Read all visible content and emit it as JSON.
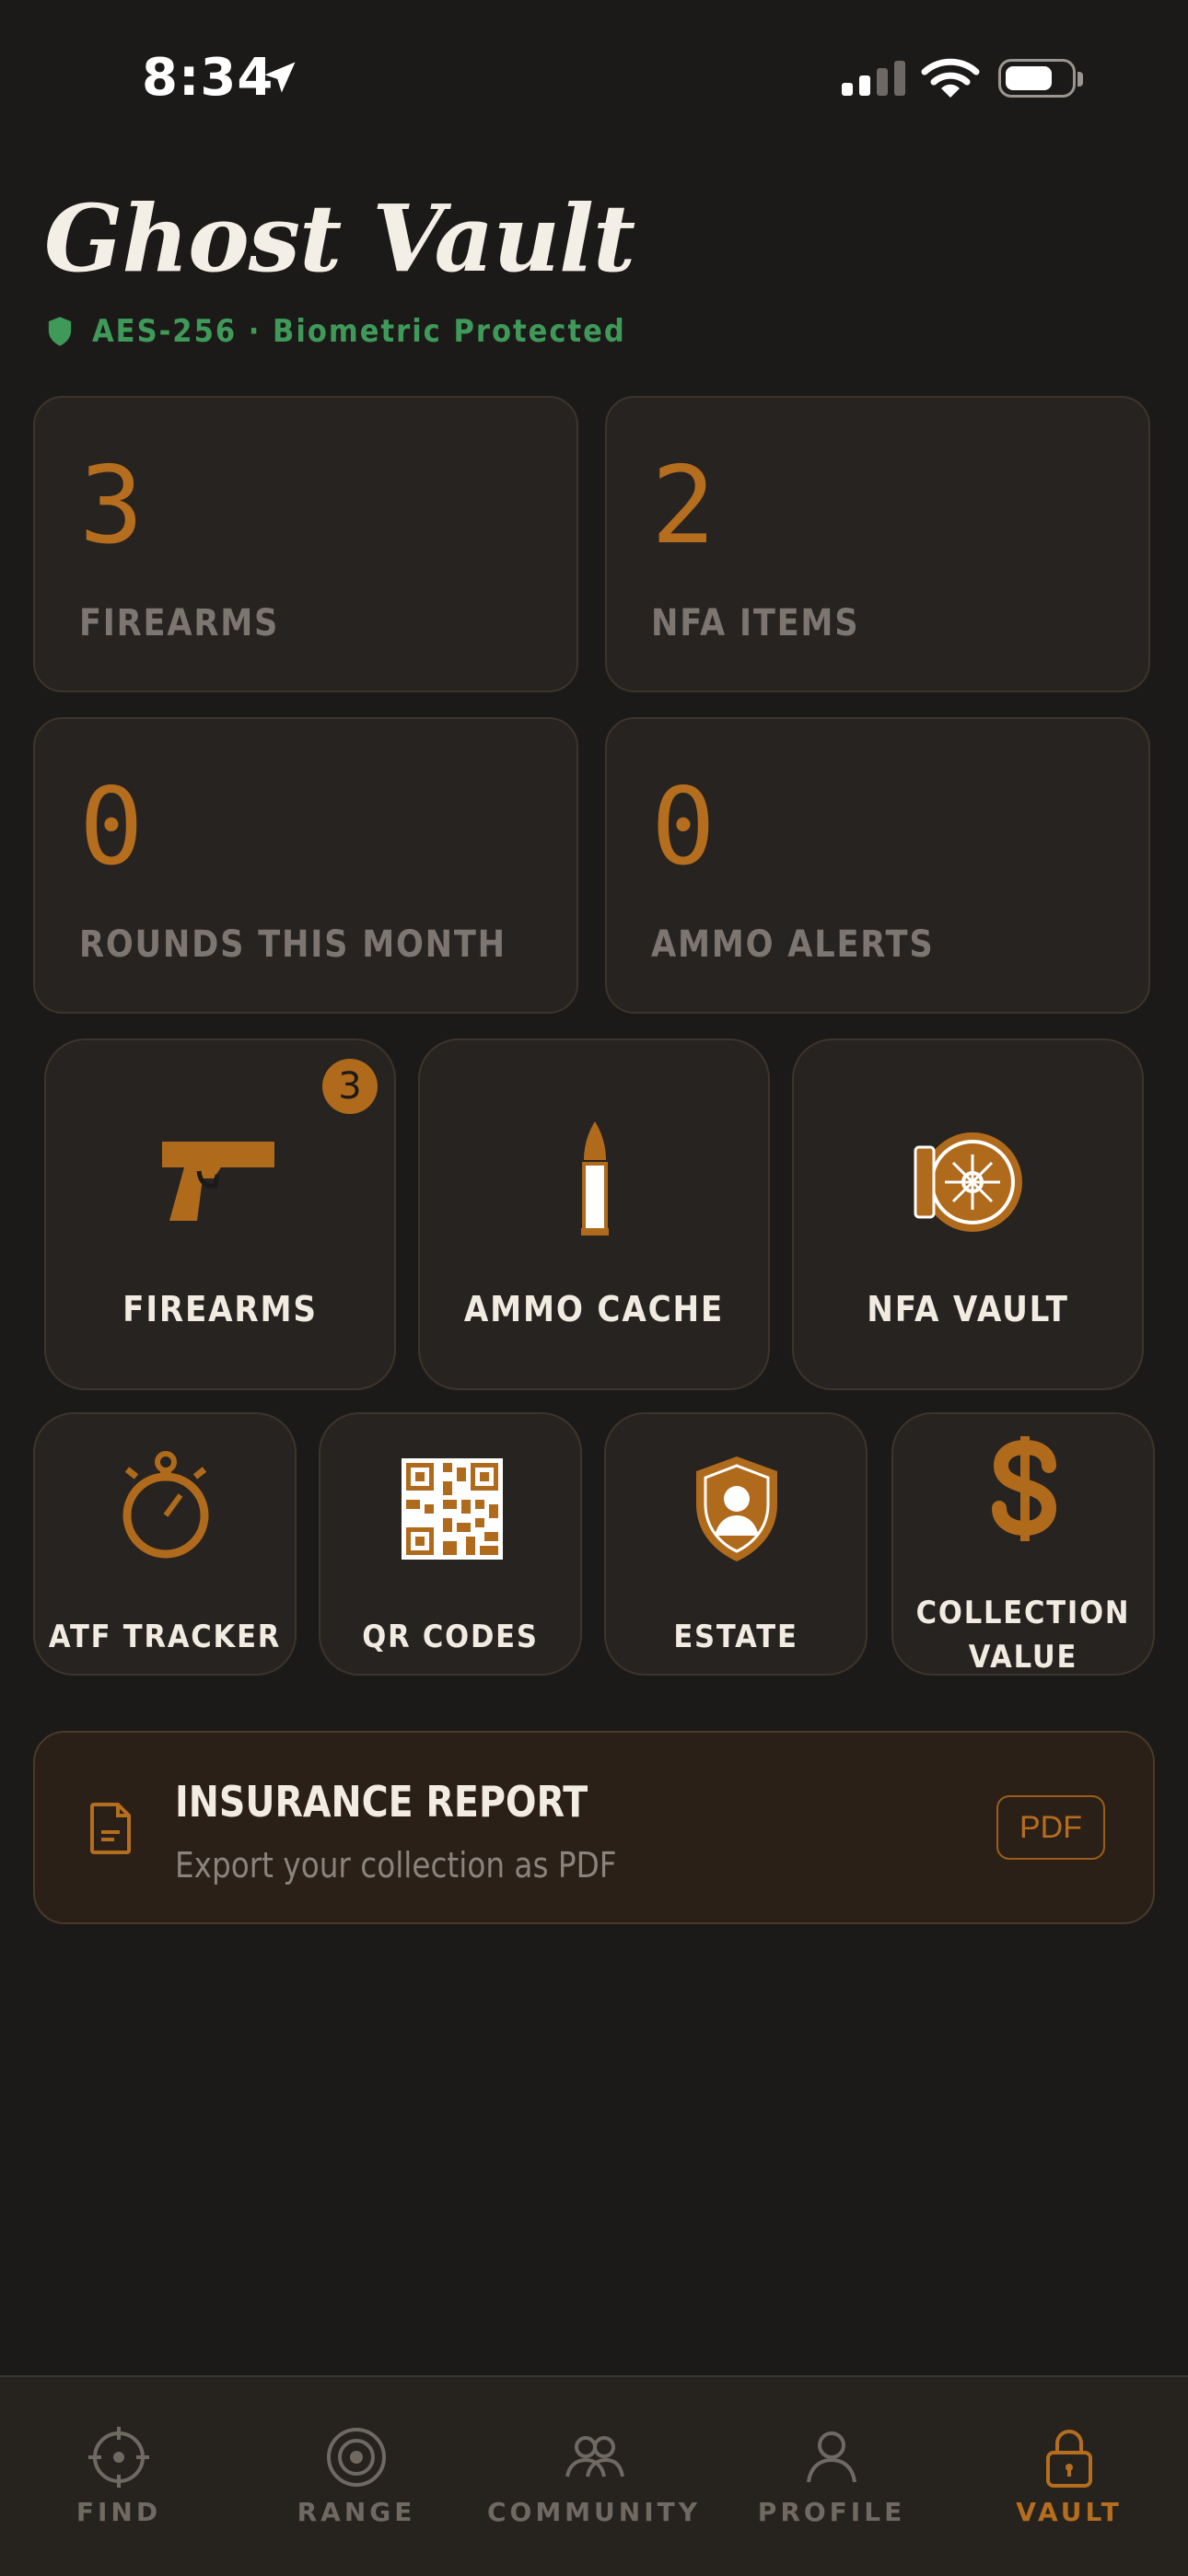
{
  "status_bar": {
    "time": "8:34"
  },
  "header": {
    "title": "Ghost Vault",
    "security": "AES-256 · Biometric Protected"
  },
  "stats": [
    {
      "value": "3",
      "label": "FIREARMS"
    },
    {
      "value": "2",
      "label": "NFA ITEMS"
    },
    {
      "value": "0",
      "label": "ROUNDS THIS MONTH"
    },
    {
      "value": "0",
      "label": "AMMO ALERTS"
    }
  ],
  "tiles_main": [
    {
      "label": "FIREARMS",
      "icon": "pistol-icon",
      "badge": "3"
    },
    {
      "label": "AMMO CACHE",
      "icon": "bullet-icon"
    },
    {
      "label": "NFA VAULT",
      "icon": "vault-icon"
    }
  ],
  "tiles_small": [
    {
      "label": "ATF TRACKER",
      "icon": "stopwatch-icon"
    },
    {
      "label": "QR CODES",
      "icon": "qr-code-icon"
    },
    {
      "label": "ESTATE",
      "icon": "shield-person-icon"
    },
    {
      "label": "COLLECTION",
      "label2": "VALUE",
      "icon": "dollar-icon"
    }
  ],
  "report": {
    "title": "INSURANCE REPORT",
    "subtitle": "Export your collection as PDF",
    "button": "PDF"
  },
  "tabs": [
    {
      "label": "FIND",
      "icon": "crosshair-icon"
    },
    {
      "label": "RANGE",
      "icon": "target-icon"
    },
    {
      "label": "COMMUNITY",
      "icon": "community-icon"
    },
    {
      "label": "PROFILE",
      "icon": "profile-icon"
    },
    {
      "label": "VAULT",
      "icon": "lock-icon",
      "active": true
    }
  ],
  "colors": {
    "background": "#1c1a18",
    "accent": "#b56d1e",
    "secure_green": "#3f9a5a",
    "card": "#262320"
  }
}
